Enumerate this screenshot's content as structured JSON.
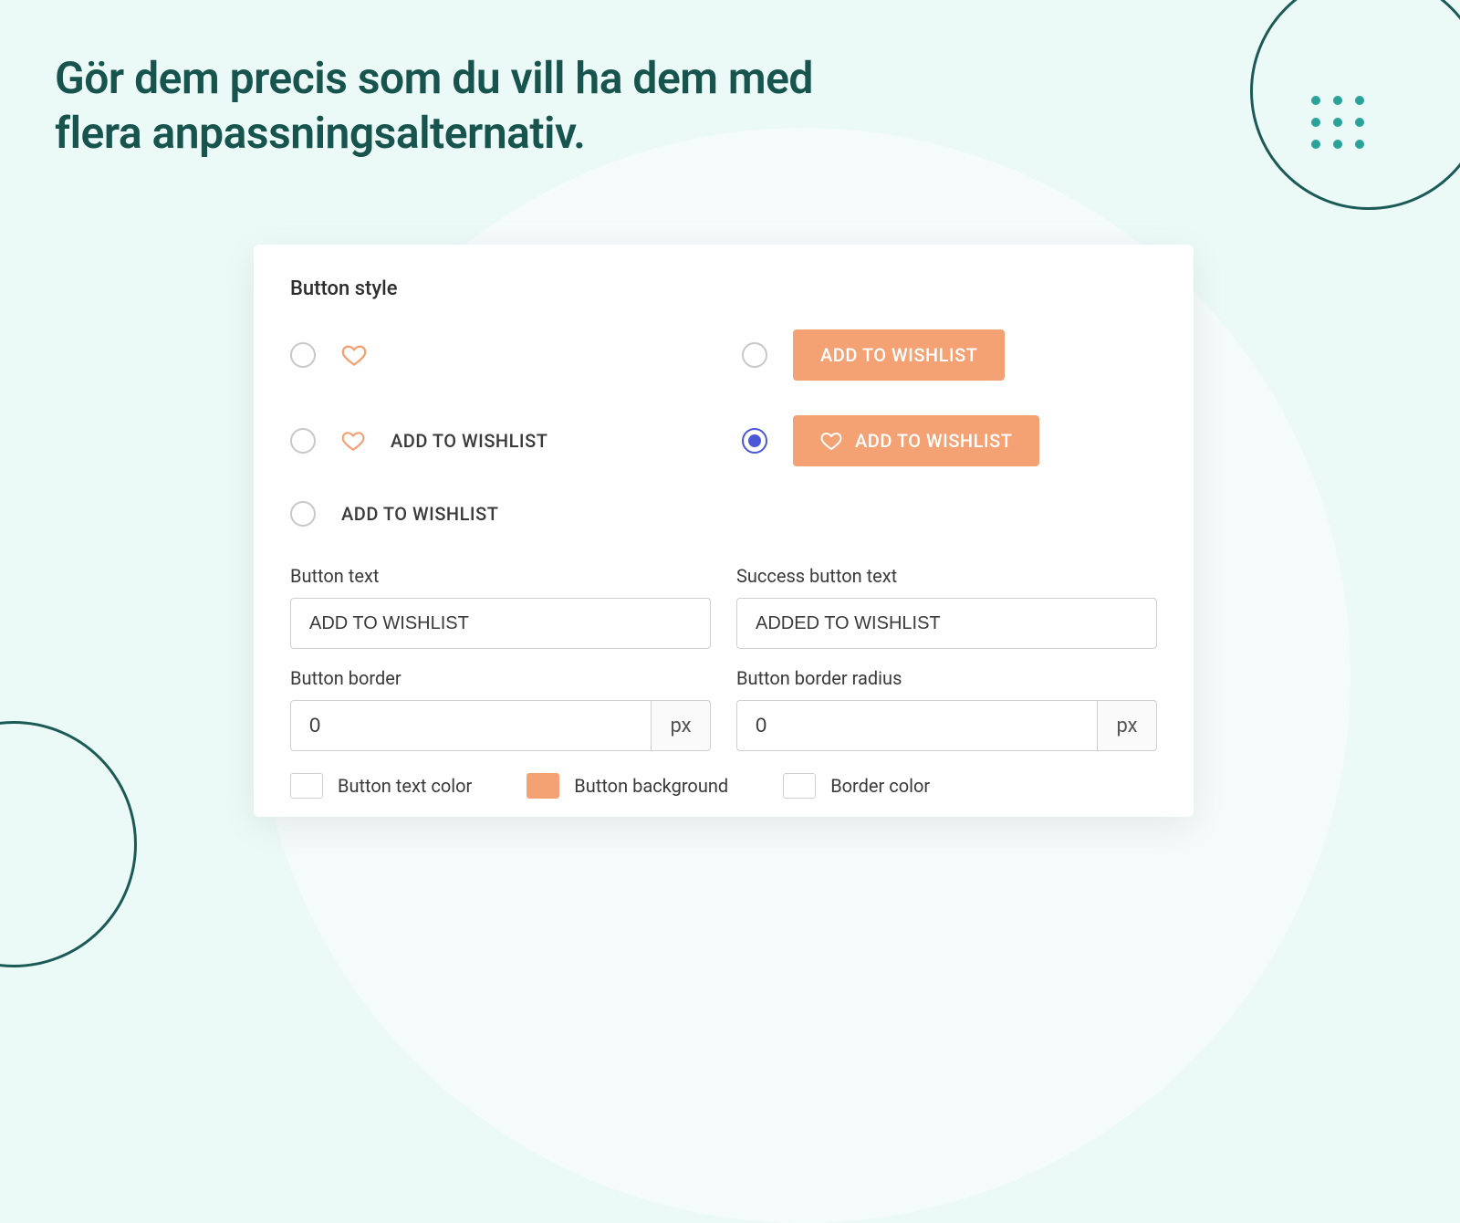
{
  "headline": "Gör dem precis som du vill ha dem med flera anpassningsalternativ.",
  "panel": {
    "title": "Button style",
    "styles": {
      "icon_heart_text": "ADD TO WISHLIST",
      "text_only": "ADD TO WISHLIST",
      "btn_solid": "ADD TO WISHLIST",
      "btn_solid_icon": "ADD TO WISHLIST",
      "selected_index": 3
    },
    "fields": {
      "button_text_label": "Button text",
      "button_text_value": "ADD TO WISHLIST",
      "success_text_label": "Success button text",
      "success_text_value": "ADDED TO WISHLIST",
      "border_label": "Button border",
      "border_value": "0",
      "border_unit": "px",
      "radius_label": "Button border radius",
      "radius_value": "0",
      "radius_unit": "px"
    },
    "colors": {
      "text_label": "Button text color",
      "bg_label": "Button background",
      "border_label": "Border color",
      "bg_hex": "#f4a274"
    }
  }
}
